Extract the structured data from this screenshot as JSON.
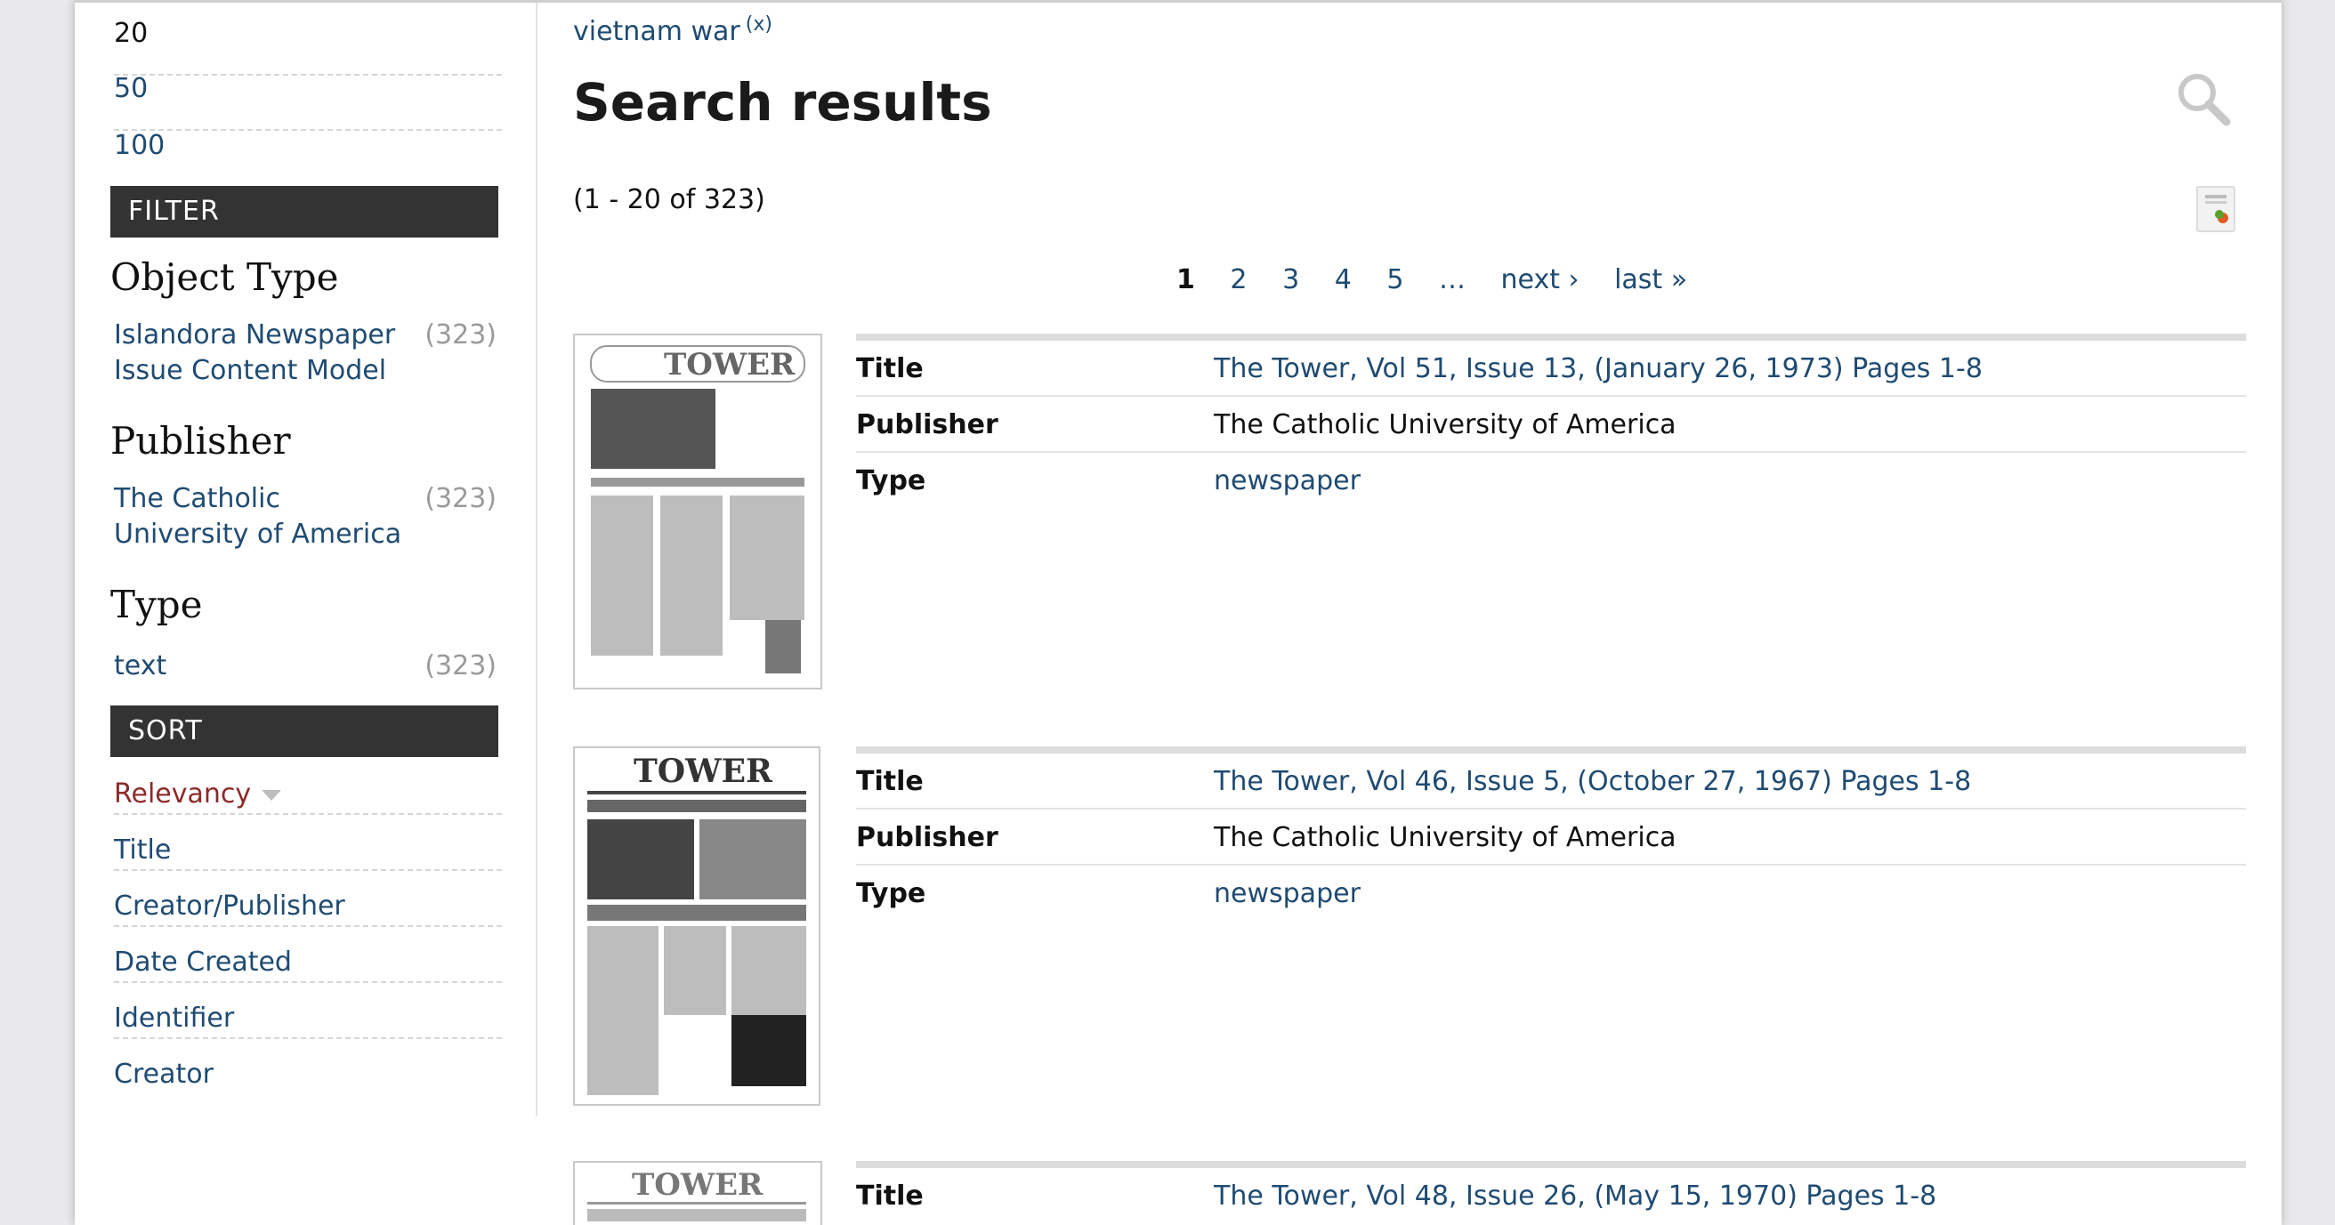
{
  "per_page": [
    "20",
    "50",
    "100"
  ],
  "filter": {
    "heading": "FILTER",
    "facets": [
      {
        "heading": "Object Type",
        "items": [
          {
            "label": "Islandora Newspaper Issue Content Model",
            "count": "(323)"
          }
        ]
      },
      {
        "heading": "Publisher",
        "items": [
          {
            "label": "The Catholic University of America",
            "count": "(323)"
          }
        ]
      },
      {
        "heading": "Type",
        "items": [
          {
            "label": "text",
            "count": "(323)"
          }
        ]
      }
    ]
  },
  "sort": {
    "heading": "SORT",
    "items": [
      "Relevancy",
      "Title",
      "Creator/Publisher",
      "Date Created",
      "Identifier",
      "Creator"
    ],
    "active": "Relevancy"
  },
  "breadcrumb": {
    "term": "vietnam war",
    "remove": "(x)"
  },
  "title": "Search results",
  "count_text": "(1 - 20 of 323)",
  "pager": {
    "pages": [
      "1",
      "2",
      "3",
      "4",
      "5"
    ],
    "current": "1",
    "ellipsis": "…",
    "next": "next ›",
    "last": "last »"
  },
  "labels": {
    "title": "Title",
    "publisher": "Publisher",
    "type": "Type"
  },
  "results": [
    {
      "title": "The Tower, Vol 51, Issue 13, (January 26, 1973) Pages 1-8",
      "publisher": "The Catholic University of America",
      "type": "newspaper",
      "masthead": "TOWER"
    },
    {
      "title": "The Tower, Vol 46, Issue 5, (October 27, 1967) Pages 1-8",
      "publisher": "The Catholic University of America",
      "type": "newspaper",
      "masthead": "TOWER"
    },
    {
      "title": "The Tower, Vol 48, Issue 26, (May 15, 1970) Pages 1-8",
      "publisher": "",
      "type": "",
      "masthead": "TOWER"
    }
  ],
  "icons": {
    "search": "magnifier-icon",
    "rss": "rss-feed-icon"
  }
}
